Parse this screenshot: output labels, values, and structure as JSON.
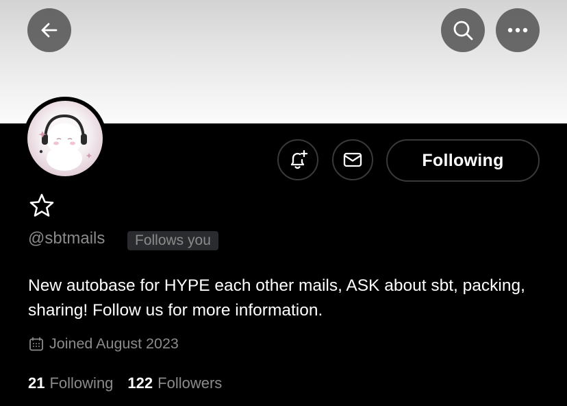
{
  "banner": {
    "back_icon": "arrow-left-icon",
    "search_icon": "search-icon",
    "more_icon": "more-horizontal-icon",
    "colors": {
      "top": "#d3d3d3",
      "bottom": "#fbfbfb"
    }
  },
  "profile": {
    "avatar_icon": "avatar",
    "verified_icon": "star-outline-icon",
    "handle": "@sbtmails",
    "follows_you": "Follows you",
    "bio": "New autobase for HYPE each other mails, ASK about sbt, packing, sharing! Follow us for more information.",
    "joined": "Joined August 2023",
    "following_count": "21",
    "following_label": "Following",
    "followers_count": "122",
    "followers_label": "Followers"
  },
  "actions": {
    "notify_icon": "bell-plus-icon",
    "mail_icon": "envelope-icon",
    "following_button": "Following"
  },
  "colors": {
    "background": "#000000",
    "text_primary": "#ffffff",
    "text_secondary": "#8b8b8b",
    "border": "#3a3a3a",
    "badge_bg": "#2a2b2e"
  }
}
